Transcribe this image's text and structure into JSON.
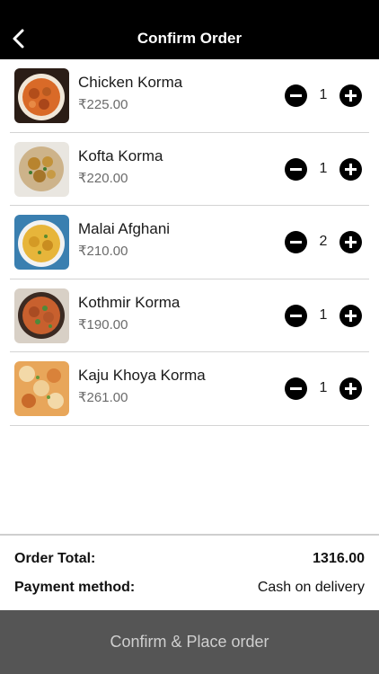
{
  "header": {
    "title": "Confirm Order",
    "back_icon": "chevron-left-icon"
  },
  "items": [
    {
      "name": "Chicken Korma",
      "price": "₹225.00",
      "qty": "1"
    },
    {
      "name": "Kofta Korma",
      "price": "₹220.00",
      "qty": "1"
    },
    {
      "name": "Malai Afghani",
      "price": "₹210.00",
      "qty": "2"
    },
    {
      "name": "Kothmir Korma",
      "price": "₹190.00",
      "qty": "1"
    },
    {
      "name": "Kaju Khoya Korma",
      "price": "₹261.00",
      "qty": "1"
    }
  ],
  "summary": {
    "total_label": "Order Total:",
    "total_value": "1316.00",
    "payment_label": "Payment method:",
    "payment_value": "Cash on delivery"
  },
  "footer": {
    "confirm_label": "Confirm & Place order"
  },
  "colors": {
    "header_bg": "#000000",
    "confirm_bg": "#555555",
    "confirm_text": "#cfcfcf"
  }
}
